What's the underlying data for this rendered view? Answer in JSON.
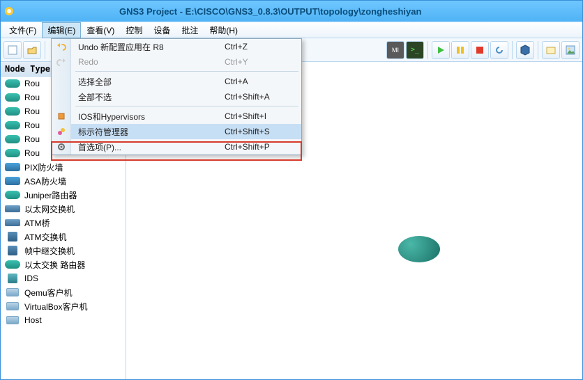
{
  "title": "GNS3 Project - E:\\CISCO\\GNS3_0.8.3\\OUTPUT\\topology\\zongheshiyan",
  "menubar": [
    {
      "label": "文件(F)"
    },
    {
      "label": "编辑(E)"
    },
    {
      "label": "查看(V)"
    },
    {
      "label": "控制"
    },
    {
      "label": "设备"
    },
    {
      "label": "批注"
    },
    {
      "label": "帮助(H)"
    }
  ],
  "sidebar_header": "Node Types",
  "nodes": [
    {
      "label": "Rou",
      "kind": "rtr"
    },
    {
      "label": "Rou",
      "kind": "rtr"
    },
    {
      "label": "Rou",
      "kind": "rtr"
    },
    {
      "label": "Rou",
      "kind": "rtr"
    },
    {
      "label": "Rou",
      "kind": "rtr"
    },
    {
      "label": "Rou",
      "kind": "rtr"
    },
    {
      "label": "PIX防火墙",
      "kind": "fw",
      "half": true
    },
    {
      "label": "ASA防火墙",
      "kind": "fw"
    },
    {
      "label": "Juniper路由器",
      "kind": "rtr"
    },
    {
      "label": "以太网交换机",
      "kind": "sw"
    },
    {
      "label": "ATM桥",
      "kind": "sw"
    },
    {
      "label": "ATM交换机",
      "kind": "sq"
    },
    {
      "label": "帧中继交换机",
      "kind": "sq"
    },
    {
      "label": "以太交换 路由器",
      "kind": "rtr"
    },
    {
      "label": "IDS",
      "kind": "sq"
    },
    {
      "label": "Qemu客户机",
      "kind": "mon"
    },
    {
      "label": "VirtualBox客户机",
      "kind": "mon"
    },
    {
      "label": "Host",
      "kind": "mon"
    }
  ],
  "menu": {
    "undo": {
      "label": "Undo 新配置应用在 R8",
      "shortcut": "Ctrl+Z"
    },
    "redo": {
      "label": "Redo",
      "shortcut": "Ctrl+Y"
    },
    "selall": {
      "label": "选择全部",
      "shortcut": "Ctrl+A"
    },
    "selnone": {
      "label": "全部不选",
      "shortcut": "Ctrl+Shift+A"
    },
    "ios": {
      "label": "IOS和Hypervisors",
      "shortcut": "Ctrl+Shift+I"
    },
    "symmgr": {
      "label": "标示符管理器",
      "shortcut": "Ctrl+Shift+S"
    },
    "prefs": {
      "label": "首选项(P)...",
      "shortcut": "Ctrl+Shift+P"
    }
  }
}
